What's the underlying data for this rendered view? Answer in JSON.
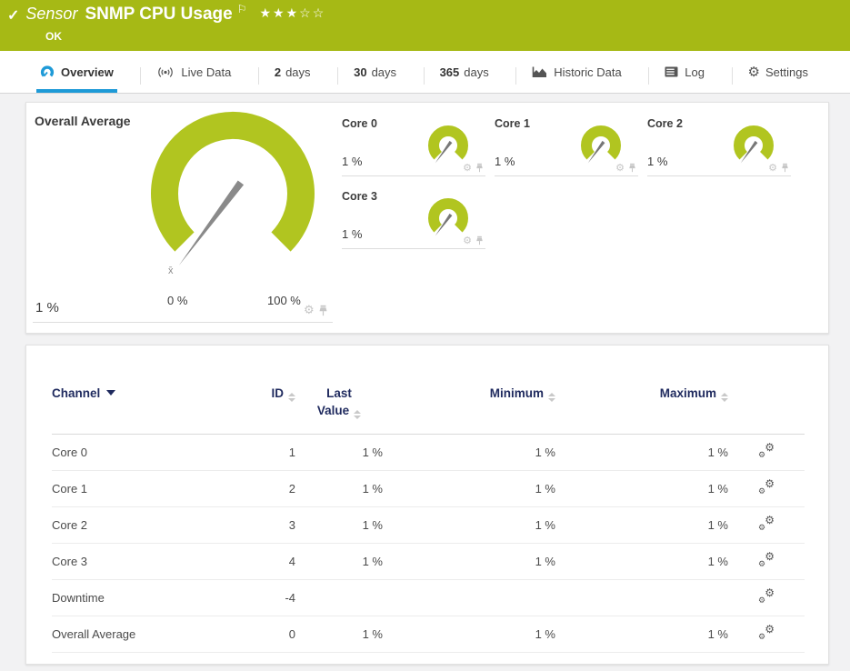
{
  "header": {
    "status_icon": "✓",
    "kind": "Sensor",
    "title": "SNMP CPU Usage",
    "stars": "★★★☆☆",
    "status": "OK"
  },
  "tabs": {
    "items": [
      {
        "label": "Overview"
      },
      {
        "label": "Live Data"
      },
      {
        "num": "2",
        "label": "days"
      },
      {
        "num": "30",
        "label": "days"
      },
      {
        "num": "365",
        "label": "days"
      },
      {
        "label": "Historic Data"
      },
      {
        "label": "Log"
      },
      {
        "label": "Settings"
      }
    ]
  },
  "gauges": {
    "overall": {
      "title": "Overall Average",
      "value": "1 %",
      "min_label": "0 %",
      "max_label": "100 %",
      "avg_marker": "x̄"
    },
    "cores": [
      {
        "label": "Core 0",
        "value": "1 %"
      },
      {
        "label": "Core 1",
        "value": "1 %"
      },
      {
        "label": "Core 2",
        "value": "1 %"
      },
      {
        "label": "Core 3",
        "value": "1 %"
      }
    ]
  },
  "table": {
    "columns": [
      "Channel",
      "ID",
      "Last Value",
      "Minimum",
      "Maximum"
    ],
    "rows": [
      {
        "channel": "Core 0",
        "id": "1",
        "last": "1 %",
        "min": "1 %",
        "max": "1 %"
      },
      {
        "channel": "Core 1",
        "id": "2",
        "last": "1 %",
        "min": "1 %",
        "max": "1 %"
      },
      {
        "channel": "Core 2",
        "id": "3",
        "last": "1 %",
        "min": "1 %",
        "max": "1 %"
      },
      {
        "channel": "Core 3",
        "id": "4",
        "last": "1 %",
        "min": "1 %",
        "max": "1 %"
      },
      {
        "channel": "Downtime",
        "id": "-4",
        "last": "",
        "min": "",
        "max": ""
      },
      {
        "channel": "Overall Average",
        "id": "0",
        "last": "1 %",
        "min": "1 %",
        "max": "1 %"
      }
    ]
  },
  "colors": {
    "header_green": "#a6b915",
    "gauge_green": "#b1c520",
    "active_tab_blue": "#1e9ad7",
    "table_header_navy": "#1f2a5e",
    "status_ok_text": "#ffffff"
  }
}
